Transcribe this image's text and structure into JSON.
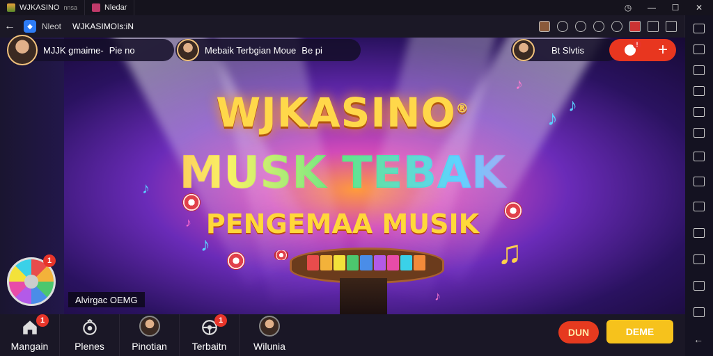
{
  "browser": {
    "tab1_title": "WJKASINO",
    "tab1_suffix": "nnsa",
    "tab2_title": "Nledar",
    "address_prefix": "Nleot",
    "address_url": "WJKASIMOIs:iN",
    "controls": [
      "⌚",
      "—",
      "□",
      "✕"
    ]
  },
  "top_users": [
    {
      "name": "MJJK gmaime-",
      "extra": "Pie no"
    },
    {
      "name": "Mebaik Terbgian Moue",
      "extra": "Be pi"
    },
    {
      "name": "Bt Slvtis",
      "extra": ""
    }
  ],
  "banner": {
    "line1": "WJKASINO",
    "registered": "®",
    "line2": "MUSK TEBAK",
    "line3": "PENGEMAA MUSIK"
  },
  "ticker": {
    "text": "Alvirgac OEMG"
  },
  "badges": {
    "wheel": "1",
    "home": "1",
    "tab4": "1",
    "top": "!"
  },
  "nav": [
    {
      "label": "Mangain"
    },
    {
      "label": "Plenes"
    },
    {
      "label": "Pinotian"
    },
    {
      "label": "Terbaitn"
    },
    {
      "label": "Wilunia"
    }
  ],
  "actions": {
    "red_label": "DUN",
    "yellow_label": "DEME",
    "top_plus": "+"
  },
  "colors": {
    "accent_red": "#e63a1f",
    "accent_yellow": "#f6c21c",
    "bg": "#1a1726"
  }
}
